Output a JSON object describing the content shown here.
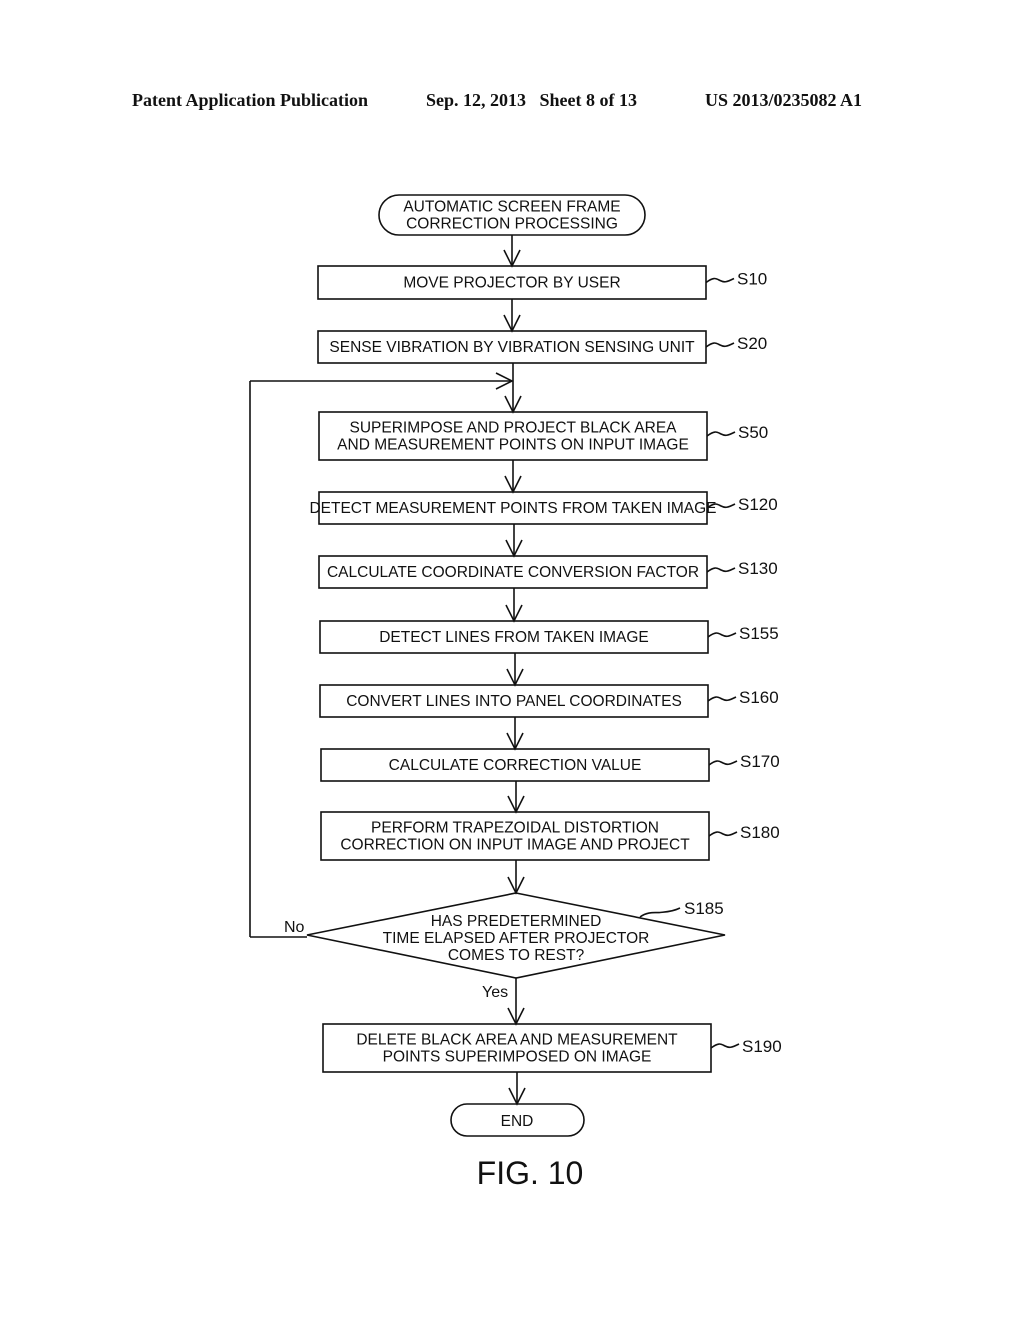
{
  "header": {
    "publication": "Patent Application Publication",
    "date_sheet": "Sep. 12, 2013   Sheet 8 of 13",
    "number": "US 2013/0235082 A1"
  },
  "flowchart": {
    "start": {
      "lines": [
        "AUTOMATIC SCREEN FRAME",
        "CORRECTION PROCESSING"
      ]
    },
    "steps": [
      {
        "id": "S10",
        "lines": [
          "MOVE PROJECTOR BY USER"
        ]
      },
      {
        "id": "S20",
        "lines": [
          "SENSE VIBRATION BY VIBRATION SENSING UNIT"
        ]
      },
      {
        "id": "S50",
        "lines": [
          "SUPERIMPOSE AND PROJECT BLACK AREA",
          "AND MEASUREMENT POINTS ON INPUT IMAGE"
        ]
      },
      {
        "id": "S120",
        "lines": [
          "DETECT MEASUREMENT POINTS FROM TAKEN IMAGE"
        ]
      },
      {
        "id": "S130",
        "lines": [
          "CALCULATE COORDINATE CONVERSION FACTOR"
        ]
      },
      {
        "id": "S155",
        "lines": [
          "DETECT LINES FROM TAKEN IMAGE"
        ]
      },
      {
        "id": "S160",
        "lines": [
          "CONVERT LINES INTO PANEL COORDINATES"
        ]
      },
      {
        "id": "S170",
        "lines": [
          "CALCULATE CORRECTION VALUE"
        ]
      },
      {
        "id": "S180",
        "lines": [
          "PERFORM TRAPEZOIDAL DISTORTION",
          "CORRECTION ON INPUT IMAGE AND PROJECT"
        ]
      }
    ],
    "decision": {
      "id": "S185",
      "lines": [
        "HAS PREDETERMINED",
        "TIME ELAPSED AFTER PROJECTOR",
        "COMES TO REST?"
      ],
      "no_label": "No",
      "yes_label": "Yes"
    },
    "final_step": {
      "id": "S190",
      "lines": [
        "DELETE BLACK AREA AND MEASUREMENT",
        "POINTS SUPERIMPOSED ON IMAGE"
      ]
    },
    "end": {
      "label": "END"
    }
  },
  "figure_label": "FIG. 10"
}
